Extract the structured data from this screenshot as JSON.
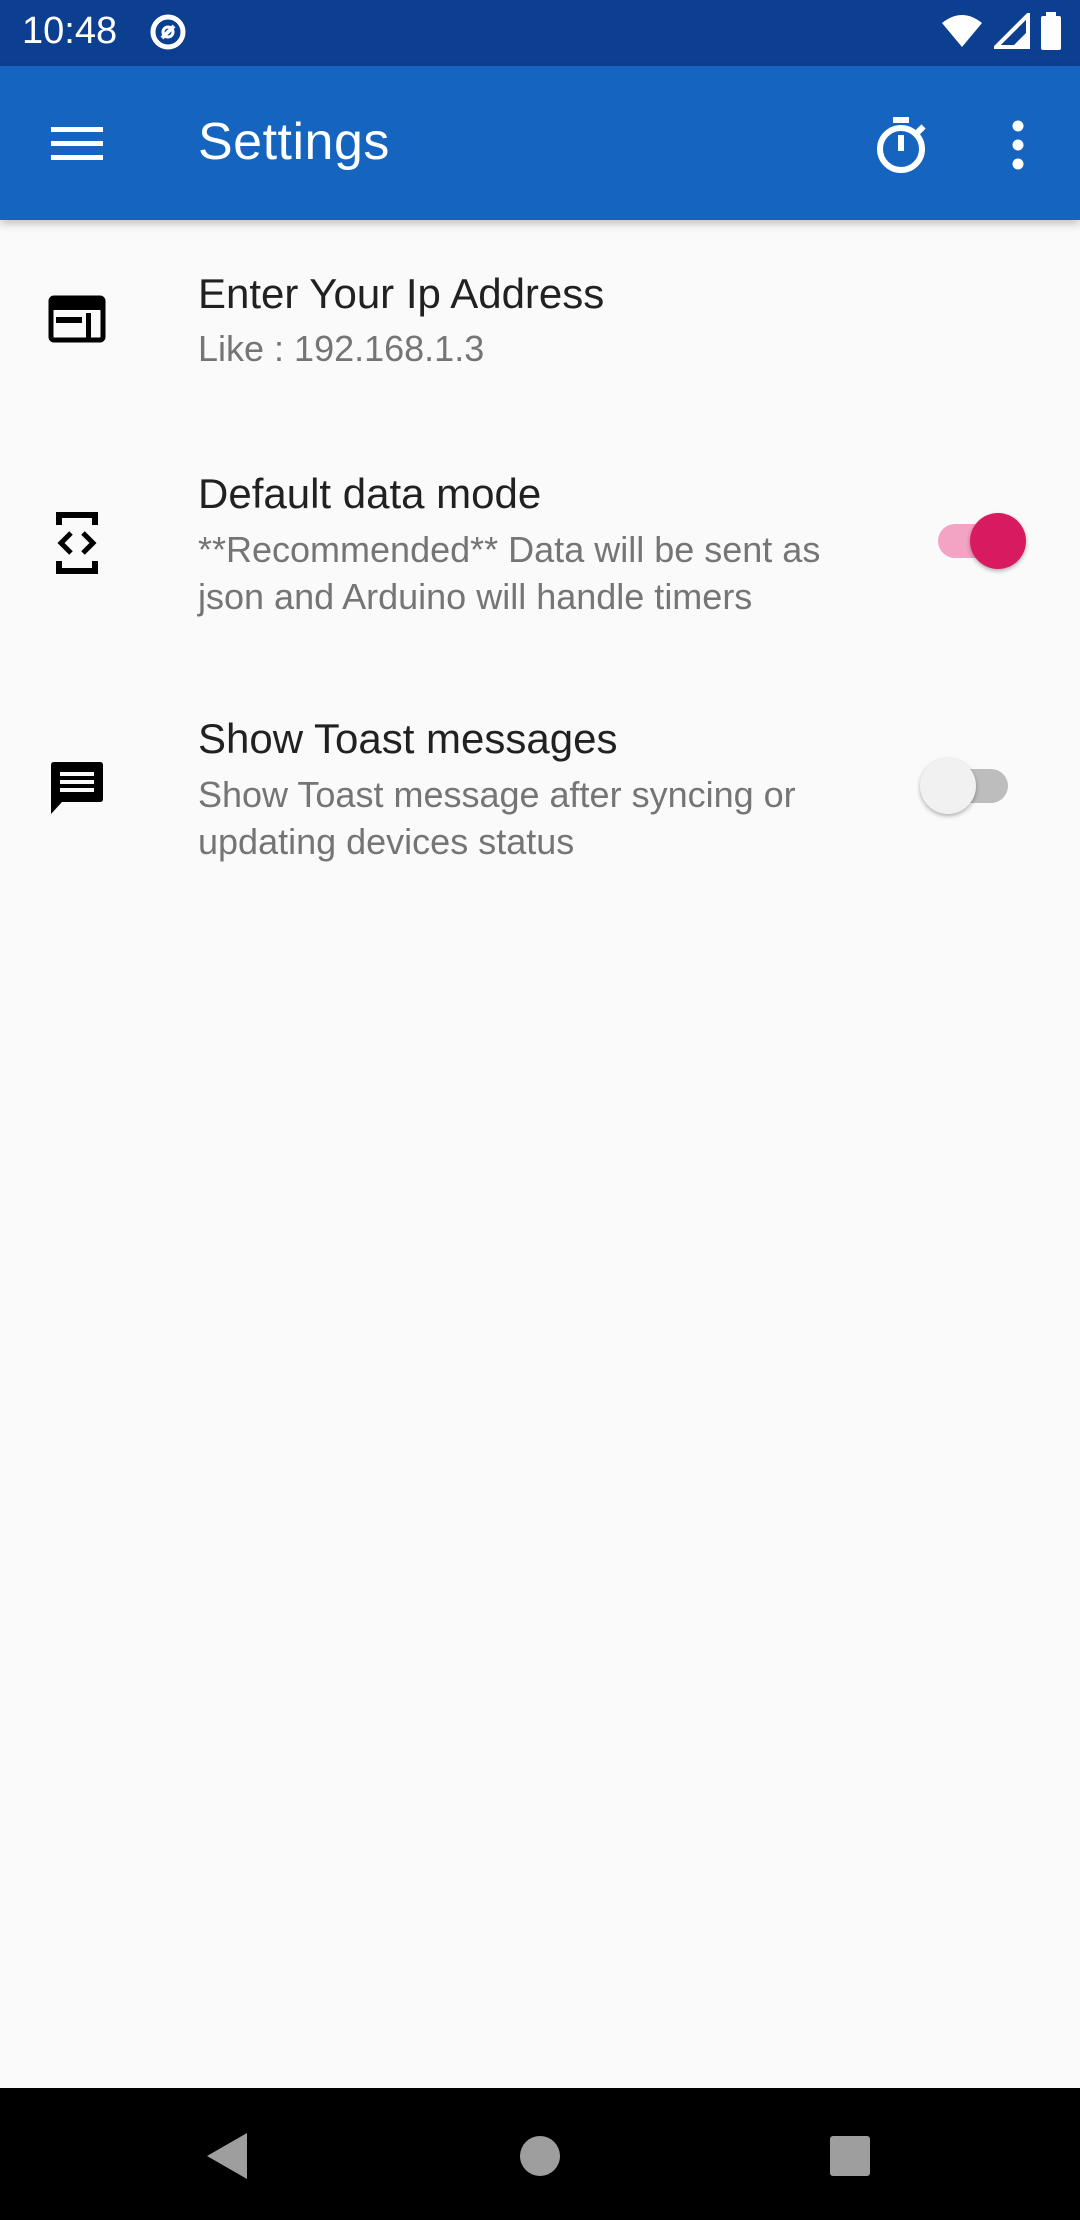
{
  "status_bar": {
    "time": "10:48",
    "icons": [
      "data-saver-icon",
      "wifi-icon",
      "cellular-signal-icon",
      "battery-icon"
    ]
  },
  "app_bar": {
    "title": "Settings",
    "icons": [
      "menu-icon",
      "timer-icon",
      "more-vert-icon"
    ],
    "background": "#1565c0"
  },
  "preferences": [
    {
      "icon": "web-window-icon",
      "title": "Enter Your Ip Address",
      "summary": "Like : 192.168.1.3"
    },
    {
      "icon": "code-device-icon",
      "title": "Default data mode",
      "summary": "**Recommended** Data will be sent as json and Arduino will handle timers",
      "switch_on": true
    },
    {
      "icon": "message-icon",
      "title": "Show Toast messages",
      "summary": "Show Toast message after syncing or updating devices status",
      "switch_on": false
    }
  ],
  "colors": {
    "accent": "#d81b60",
    "status_bar": "#0d3f91",
    "background": "#fafafa"
  },
  "nav_bar": {
    "icons": [
      "back-icon",
      "home-icon",
      "recents-icon"
    ]
  }
}
